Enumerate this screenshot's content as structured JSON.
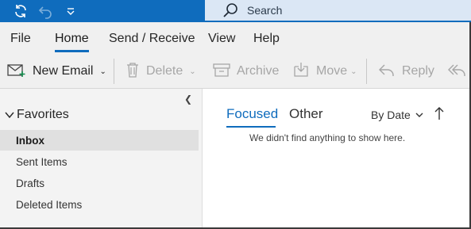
{
  "titlebar": {
    "search_placeholder": "Search",
    "accent": "#0f6cbd",
    "icons": [
      "sync-icon",
      "undo-icon",
      "customize-quick-access-icon",
      "search-icon"
    ]
  },
  "ribbon_tabs": [
    "File",
    "Home",
    "Send / Receive",
    "View",
    "Help"
  ],
  "active_tab": "Home",
  "commands": {
    "new_email": "New Email",
    "delete": "Delete",
    "archive": "Archive",
    "move": "Move",
    "reply": "Reply"
  },
  "folders": {
    "favorites_label": "Favorites",
    "items": [
      "Inbox",
      "Sent Items",
      "Drafts",
      "Deleted Items"
    ],
    "selected": "Inbox"
  },
  "message_list": {
    "tab_focused": "Focused",
    "tab_other": "Other",
    "sort_label": "By Date",
    "empty_text": "We didn't find anything to show here."
  }
}
